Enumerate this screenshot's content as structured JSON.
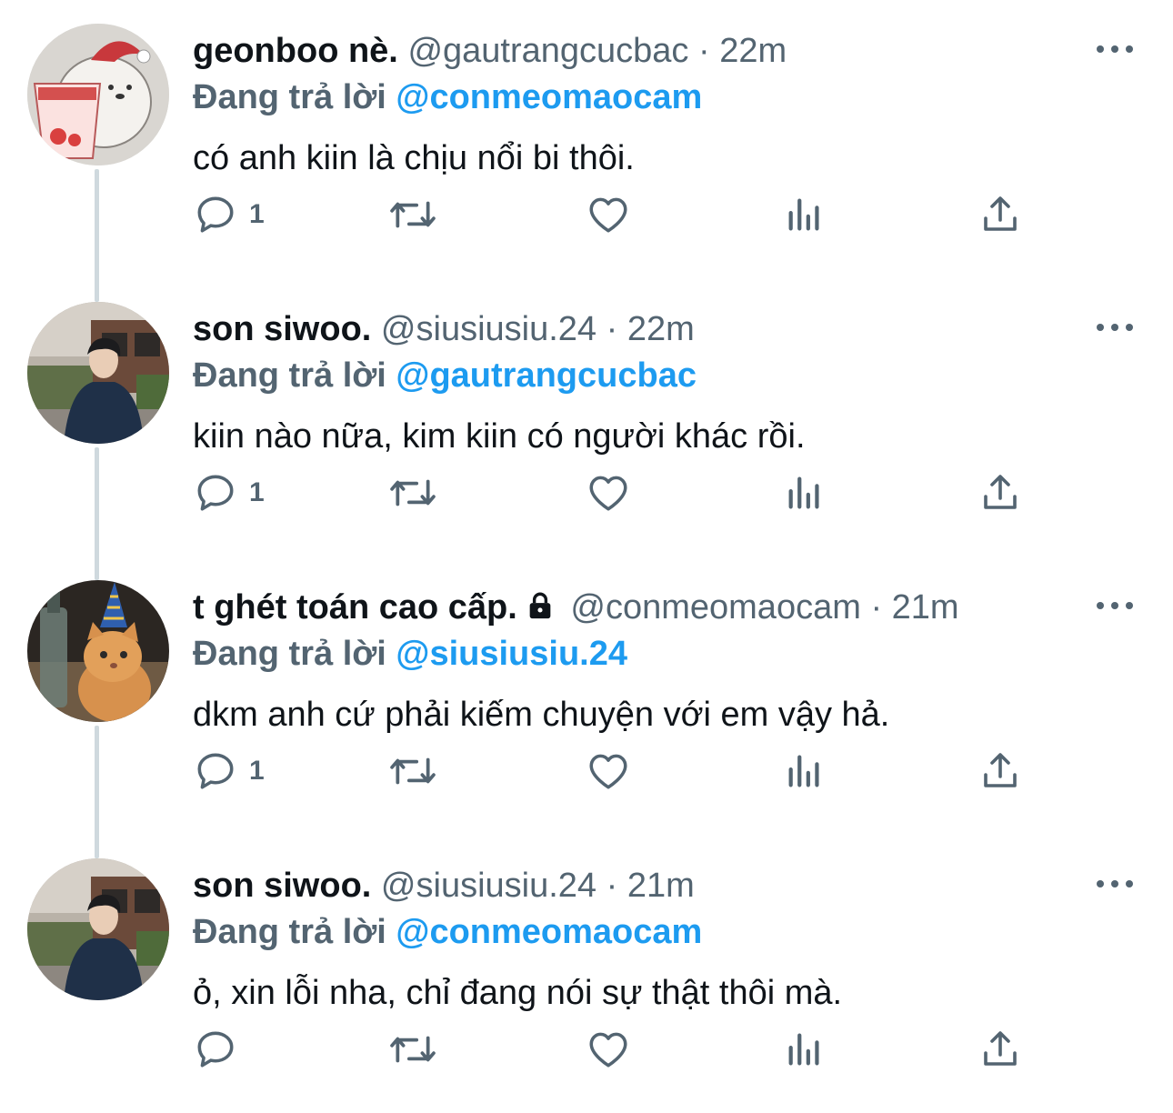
{
  "tweets": [
    {
      "display_name": "geonboo nè.",
      "handle": "@gautrangcucbac",
      "separator": "·",
      "time": "22m",
      "reply_prefix": "Đang trả lời",
      "reply_to": "@conmeomaocam",
      "text": "có anh kiin là chịu nổi bi thôi.",
      "reply_count": "1",
      "locked": false,
      "avatar_icon": "bear-avatar"
    },
    {
      "display_name": "son siwoo.",
      "handle": "@siusiusiu.24",
      "separator": "·",
      "time": "22m",
      "reply_prefix": "Đang trả lời",
      "reply_to": "@gautrangcucbac",
      "text": "kiin nào nữa, kim kiin có người khác rồi.",
      "reply_count": "1",
      "locked": false,
      "avatar_icon": "person-avatar"
    },
    {
      "display_name": "t ghét toán cao cấp.",
      "handle": "@conmeomaocam",
      "separator": "·",
      "time": "21m",
      "reply_prefix": "Đang trả lời",
      "reply_to": "@siusiusiu.24",
      "text": "dkm anh cứ phải kiếm chuyện với em vậy hả.",
      "reply_count": "1",
      "locked": true,
      "avatar_icon": "cat-party-hat-avatar"
    },
    {
      "display_name": "son siwoo.",
      "handle": "@siusiusiu.24",
      "separator": "·",
      "time": "21m",
      "reply_prefix": "Đang trả lời",
      "reply_to": "@conmeomaocam",
      "text": "ỏ, xin lỗi nha, chỉ đang nói sự thật thôi mà.",
      "reply_count": "",
      "locked": false,
      "avatar_icon": "person-avatar"
    }
  ],
  "colors": {
    "accent": "#1d9bf0",
    "secondary_text": "#536471",
    "thread_line": "#cfd9de"
  }
}
